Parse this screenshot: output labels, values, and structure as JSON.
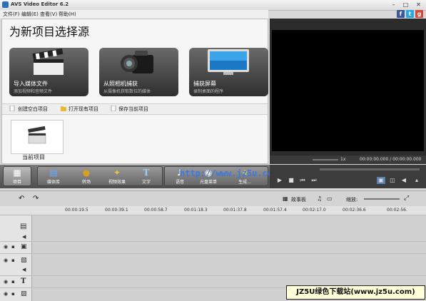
{
  "window": {
    "title": "AVS Video Editor 6.2",
    "minimize": "–",
    "maximize": "□",
    "close": "✕"
  },
  "menu": {
    "items": [
      "文件(F)",
      "编辑(E)",
      "查看(V)",
      "帮助(H)"
    ]
  },
  "social": [
    "f",
    "t",
    "g"
  ],
  "start": {
    "heading": "为新项目选择源",
    "tiles": [
      {
        "title": "导入媒体文件",
        "subtitle": "添加视频和音频文件"
      },
      {
        "title": "从照相机捕获",
        "subtitle": "从摄像机获取数位的媒体"
      },
      {
        "title": "捕获屏幕",
        "subtitle": "录制桌面的程序"
      }
    ],
    "project_actions": [
      "创建空白项目",
      "打开现有项目",
      "保存当前项目"
    ],
    "current_project_label": "当前项目"
  },
  "preview": {
    "speed": "1x",
    "time": "00:00:00.000 / 00:00:00.000"
  },
  "toolbar": {
    "buttons": [
      "项目",
      "媒体库",
      "转场",
      "视频效果",
      "文字",
      "语音",
      "光盘菜单",
      "生成..."
    ],
    "watermark_url": "http://www.jz5u.com"
  },
  "timeline": {
    "storyboard_label": "故事板",
    "zoom_label": "缩放:",
    "ruler_marks": [
      "00:00:19.5",
      "00:00:39.1",
      "00:00:58.7",
      "00:01:18.3",
      "00:01:37.8",
      "00:01:57.4",
      "00:02:17.0",
      "00:02:36.6",
      "00:02:56."
    ]
  },
  "badge": "JZ5U绿色下载站(www.jz5u.com)",
  "colors": {
    "accent": "#2a6fb8",
    "toolbar_dark": "#4e4e4e",
    "preview_bg": "#2c2c2c",
    "watermark": "#3a79e0"
  }
}
